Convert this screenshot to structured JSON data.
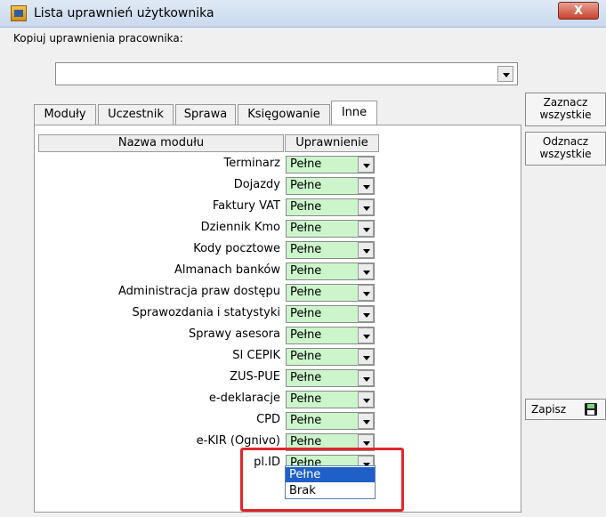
{
  "window": {
    "title": "Lista uprawnień użytkownika",
    "close_label": "X"
  },
  "copy": {
    "label": "Kopiuj uprawnienia pracownika:",
    "value": ""
  },
  "tabs": [
    {
      "label": "Moduły"
    },
    {
      "label": "Uczestnik"
    },
    {
      "label": "Sprawa"
    },
    {
      "label": "Księgowanie"
    },
    {
      "label": "Inne",
      "active": true
    }
  ],
  "table": {
    "headers": {
      "name": "Nazwa modułu",
      "permission": "Uprawnienie"
    },
    "rows": [
      {
        "name": "Terminarz",
        "permission": "Pełne"
      },
      {
        "name": "Dojazdy",
        "permission": "Pełne"
      },
      {
        "name": "Faktury VAT",
        "permission": "Pełne"
      },
      {
        "name": "Dziennik Kmo",
        "permission": "Pełne"
      },
      {
        "name": "Kody pocztowe",
        "permission": "Pełne"
      },
      {
        "name": "Almanach banków",
        "permission": "Pełne"
      },
      {
        "name": "Administracja praw dostępu",
        "permission": "Pełne"
      },
      {
        "name": "Sprawozdania i statystyki",
        "permission": "Pełne"
      },
      {
        "name": "Sprawy asesora",
        "permission": "Pełne"
      },
      {
        "name": "SI CEPIK",
        "permission": "Pełne"
      },
      {
        "name": "ZUS-PUE",
        "permission": "Pełne"
      },
      {
        "name": "e-deklaracje",
        "permission": "Pełne"
      },
      {
        "name": "CPD",
        "permission": "Pełne"
      },
      {
        "name": "e-KIR (Ognivo)",
        "permission": "Pełne"
      },
      {
        "name": "pl.ID",
        "permission": "Pełne"
      }
    ]
  },
  "dropdown": {
    "options": [
      "Pełne",
      "Brak"
    ],
    "selected": "Pełne"
  },
  "buttons": {
    "select_all": "Zaznacz wszystkie",
    "deselect_all": "Odznacz wszystkie",
    "save": "Zapisz"
  },
  "colors": {
    "permission_bg": "#ccf5cc",
    "highlight": "#e0262b",
    "selection": "#1e5fc8"
  },
  "icons": {
    "save": "floppy-disk-icon",
    "window": "app-icon",
    "dropdown": "chevron-down-icon"
  }
}
